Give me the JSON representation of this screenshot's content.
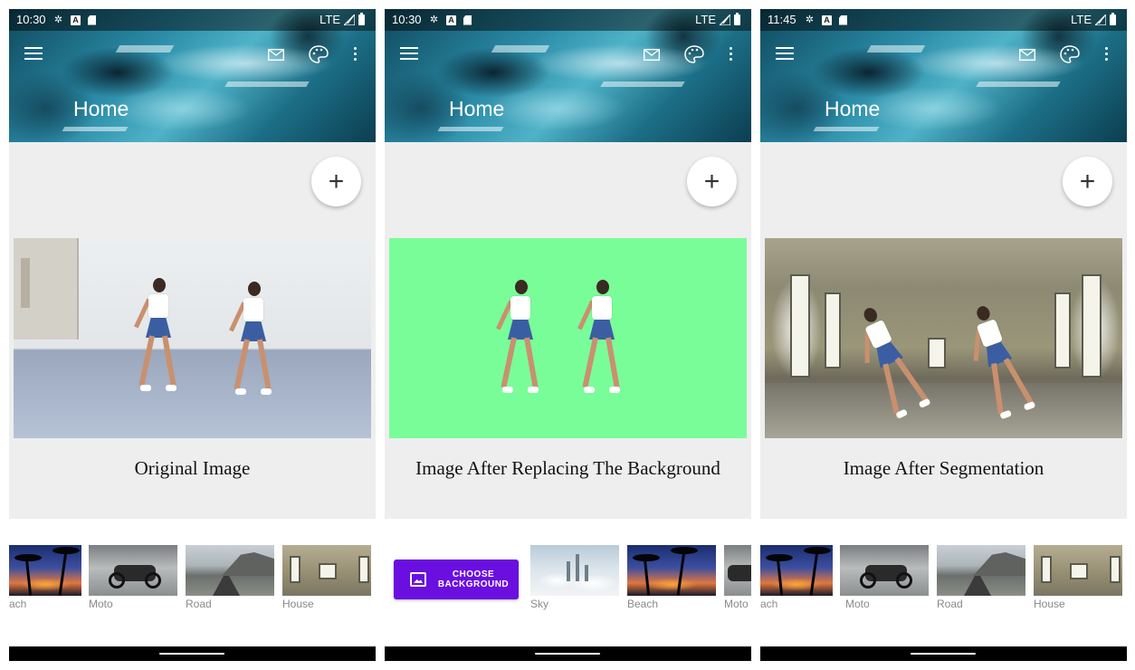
{
  "screens": [
    {
      "status_time": "10:30",
      "network": "LTE",
      "title": "Home",
      "caption": "Original Image",
      "image_kind": "original",
      "thumbnails": [
        {
          "label": "ach",
          "kind": "beach"
        },
        {
          "label": "Moto",
          "kind": "moto"
        },
        {
          "label": "Road",
          "kind": "road"
        },
        {
          "label": "House",
          "kind": "house"
        }
      ]
    },
    {
      "status_time": "10:30",
      "network": "LTE",
      "title": "Home",
      "caption": "Image After Replacing The Background",
      "image_kind": "green",
      "choose_button_label_line1": "CHOOSE",
      "choose_button_label_line2": "BACKGROUND",
      "thumbnails": [
        {
          "label": "Sky",
          "kind": "sky"
        },
        {
          "label": "Beach",
          "kind": "beach"
        },
        {
          "label": "Moto",
          "kind": "moto"
        }
      ]
    },
    {
      "status_time": "11:45",
      "network": "LTE",
      "title": "Home",
      "caption": "Image After Segmentation",
      "image_kind": "hall",
      "thumbnails": [
        {
          "label": "ach",
          "kind": "beach"
        },
        {
          "label": "Moto",
          "kind": "moto"
        },
        {
          "label": "Road",
          "kind": "road"
        },
        {
          "label": "House",
          "kind": "house"
        }
      ]
    }
  ],
  "icons": {
    "menu": "hamburger-menu-icon",
    "mail": "mail-icon",
    "palette": "palette-icon",
    "more": "more-vert-icon",
    "add": "plus-icon",
    "choose": "image-icon",
    "status_settings": "gear-icon",
    "status_a": "a-badge-icon",
    "status_sd": "sd-card-icon",
    "status_signal": "signal-icon",
    "status_battery": "battery-icon"
  },
  "colors": {
    "accent_button": "#6a0fe0",
    "green_screen": "#79fd98",
    "content_bg": "#eeeeee",
    "fab_plus": "+"
  }
}
